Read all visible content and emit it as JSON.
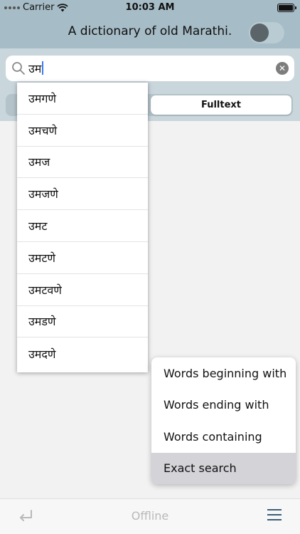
{
  "status_bar": {
    "carrier": "Carrier",
    "time": "10:03 AM",
    "wifi_icon": "wifi-icon",
    "battery_icon": "battery-icon"
  },
  "header": {
    "title": "A dictionary of old Marathi.",
    "toggle_on": false
  },
  "search": {
    "value": "उम",
    "search_icon": "search-icon",
    "clear_icon": "clear-icon"
  },
  "mode_tabs": {
    "right_label": "Fulltext"
  },
  "suggestions": [
    "उमगणे",
    "उमचणे",
    "उमज",
    "उमजणे",
    "उमट",
    "उमटणे",
    "उमटवणे",
    "उमडणे",
    "उमदणे"
  ],
  "search_type_menu": {
    "items": [
      "Words beginning with",
      "Words ending with",
      "Words containing",
      "Exact search"
    ],
    "selected": "Exact search"
  },
  "bottom_bar": {
    "status": "Offline",
    "back_icon": "return-arrow-icon",
    "menu_icon": "hamburger-menu-icon"
  },
  "colors": {
    "header_bg": "#a6bcc6",
    "search_area_bg": "#c9d6dc",
    "menu_accent": "#3a5f78"
  }
}
